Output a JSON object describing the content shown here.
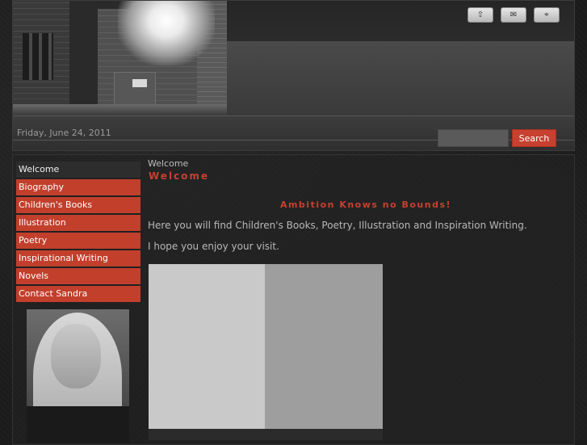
{
  "header": {
    "date": "Friday, June 24, 2011",
    "top_icons": [
      {
        "name": "home-icon",
        "glyph": "⇧"
      },
      {
        "name": "mail-icon",
        "glyph": "✉"
      },
      {
        "name": "sitemap-icon",
        "glyph": "⌖"
      }
    ],
    "search": {
      "placeholder": "",
      "value": "",
      "button_label": "Search"
    }
  },
  "sidebar": {
    "items": [
      {
        "label": "Welcome",
        "active": true
      },
      {
        "label": "Biography"
      },
      {
        "label": "Children's Books"
      },
      {
        "label": "Illustration"
      },
      {
        "label": "Poetry"
      },
      {
        "label": "Inspirational Writing"
      },
      {
        "label": "Novels"
      },
      {
        "label": "Contact Sandra"
      }
    ]
  },
  "main": {
    "breadcrumb": "Welcome",
    "title": "Welcome",
    "tagline": "Ambition Knows no Bounds!",
    "paragraphs": [
      "Here you will find Children's Books, Poetry, Illustration and Inspiration Writing.",
      "I hope you enjoy your visit."
    ]
  },
  "colors": {
    "accent": "#c8402f",
    "background": "#1c1c1c",
    "text": "#b8b8b8"
  }
}
